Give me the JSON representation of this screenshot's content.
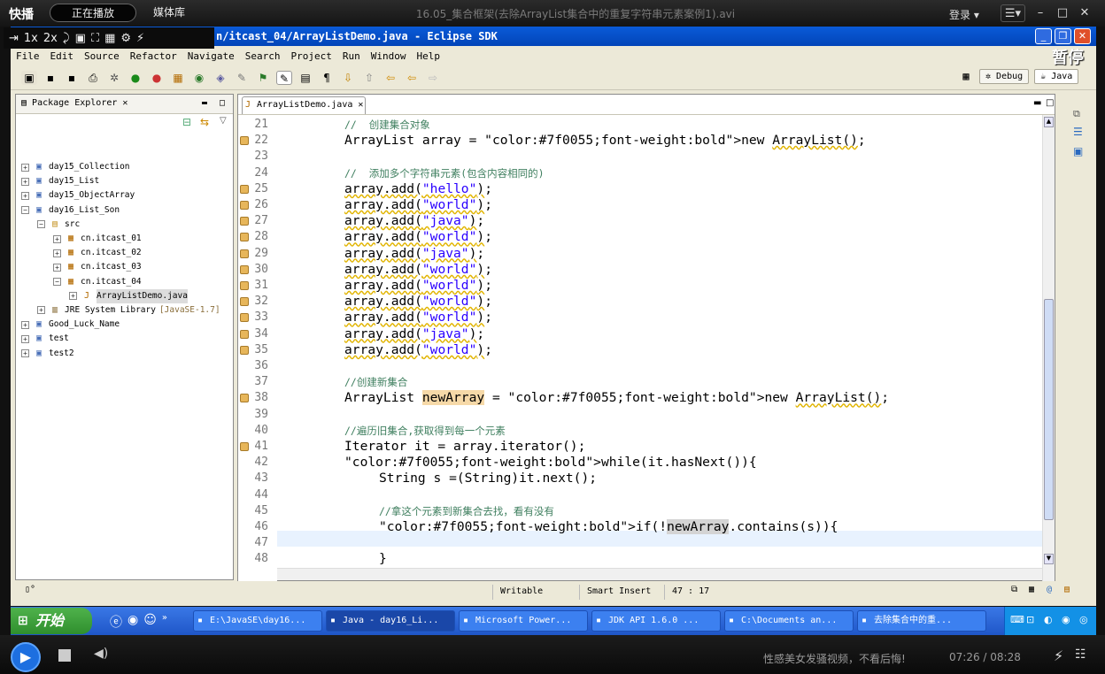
{
  "player": {
    "brand": "快播",
    "tabs": [
      "正在播放",
      "媒体库"
    ],
    "video_title": "16.05_集合框架(去除ArrayList集合中的重复字符串元素案例1).avi",
    "login": "登录",
    "overlay_tools": [
      "⇥",
      "1x",
      "2x"
    ],
    "pause_label": "暂停",
    "ad_text": "性感美女发骚视频，不看后悔!",
    "time": "07:26 / 08:28"
  },
  "eclipse": {
    "window_title": "n/itcast_04/ArrayListDemo.java - Eclipse SDK",
    "menus": [
      "File",
      "Edit",
      "Source",
      "Refactor",
      "Navigate",
      "Search",
      "Project",
      "Run",
      "Window",
      "Help"
    ],
    "perspectives": [
      "Debug",
      "Java"
    ],
    "package_explorer": {
      "title": "Package Explorer",
      "tree": [
        {
          "label": "day15_Collection",
          "level": 0,
          "expanded": false
        },
        {
          "label": "day15_List",
          "level": 0,
          "expanded": false
        },
        {
          "label": "day15_ObjectArray",
          "level": 0,
          "expanded": false
        },
        {
          "label": "day16_List_Son",
          "level": 0,
          "expanded": true
        },
        {
          "label": "src",
          "level": 1,
          "expanded": true
        },
        {
          "label": "cn.itcast_01",
          "level": 2,
          "expanded": false
        },
        {
          "label": "cn.itcast_02",
          "level": 2,
          "expanded": false
        },
        {
          "label": "cn.itcast_03",
          "level": 2,
          "expanded": false
        },
        {
          "label": "cn.itcast_04",
          "level": 2,
          "expanded": true
        },
        {
          "label": "ArrayListDemo.java",
          "level": 3,
          "expanded": false,
          "selected": true
        },
        {
          "label": "JRE System Library",
          "suffix": "[JavaSE-1.7]",
          "level": 1,
          "expanded": false
        },
        {
          "label": "Good_Luck_Name",
          "level": 0,
          "expanded": false
        },
        {
          "label": "test",
          "level": 0,
          "expanded": false
        },
        {
          "label": "test2",
          "level": 0,
          "expanded": false
        }
      ]
    },
    "editor_tab": "ArrayListDemo.java",
    "code_lines": [
      {
        "n": "21",
        "text": "//  创建集合对象",
        "indent": 0,
        "cls": "cm",
        "marker": false
      },
      {
        "n": "22",
        "text": "ArrayList array = new ArrayList();",
        "indent": 0,
        "cls": "",
        "marker": true
      },
      {
        "n": "23",
        "text": "",
        "indent": 0,
        "cls": "",
        "marker": false
      },
      {
        "n": "24",
        "text": "//  添加多个字符串元素(包含内容相同的)",
        "indent": 0,
        "cls": "cm",
        "marker": false
      },
      {
        "n": "25",
        "text": "array.add(\"hello\");",
        "indent": 0,
        "cls": "",
        "marker": true
      },
      {
        "n": "26",
        "text": "array.add(\"world\");",
        "indent": 0,
        "cls": "",
        "marker": true
      },
      {
        "n": "27",
        "text": "array.add(\"java\");",
        "indent": 0,
        "cls": "",
        "marker": true
      },
      {
        "n": "28",
        "text": "array.add(\"world\");",
        "indent": 0,
        "cls": "",
        "marker": true
      },
      {
        "n": "29",
        "text": "array.add(\"java\");",
        "indent": 0,
        "cls": "",
        "marker": true
      },
      {
        "n": "30",
        "text": "array.add(\"world\");",
        "indent": 0,
        "cls": "",
        "marker": true
      },
      {
        "n": "31",
        "text": "array.add(\"world\");",
        "indent": 0,
        "cls": "",
        "marker": true
      },
      {
        "n": "32",
        "text": "array.add(\"world\");",
        "indent": 0,
        "cls": "",
        "marker": true
      },
      {
        "n": "33",
        "text": "array.add(\"world\");",
        "indent": 0,
        "cls": "",
        "marker": true
      },
      {
        "n": "34",
        "text": "array.add(\"java\");",
        "indent": 0,
        "cls": "",
        "marker": true
      },
      {
        "n": "35",
        "text": "array.add(\"world\");",
        "indent": 0,
        "cls": "",
        "marker": true
      },
      {
        "n": "36",
        "text": "",
        "indent": 0,
        "cls": "",
        "marker": false
      },
      {
        "n": "37",
        "text": "//创建新集合",
        "indent": 0,
        "cls": "cm",
        "marker": false
      },
      {
        "n": "38",
        "text": "ArrayList newArray = new ArrayList();",
        "indent": 0,
        "cls": "",
        "marker": true
      },
      {
        "n": "39",
        "text": "",
        "indent": 0,
        "cls": "",
        "marker": false
      },
      {
        "n": "40",
        "text": "//遍历旧集合,获取得到每一个元素",
        "indent": 0,
        "cls": "cm",
        "marker": false
      },
      {
        "n": "41",
        "text": "Iterator it = array.iterator();",
        "indent": 0,
        "cls": "",
        "marker": true
      },
      {
        "n": "42",
        "text": "while(it.hasNext()){",
        "indent": 0,
        "cls": "",
        "marker": false
      },
      {
        "n": "43",
        "text": "String s =(String)it.next();",
        "indent": 1,
        "cls": "",
        "marker": false
      },
      {
        "n": "44",
        "text": "",
        "indent": 0,
        "cls": "",
        "marker": false
      },
      {
        "n": "45",
        "text": "//拿这个元素到新集合去找，看有没有",
        "indent": 1,
        "cls": "cm",
        "marker": false
      },
      {
        "n": "46",
        "text": "if(!newArray.contains(s)){",
        "indent": 1,
        "cls": "",
        "marker": false
      },
      {
        "n": "47",
        "text": "",
        "indent": 0,
        "cls": "",
        "marker": false
      },
      {
        "n": "48",
        "text": "}",
        "indent": 1,
        "cls": "",
        "marker": false
      }
    ],
    "status": {
      "writable": "Writable",
      "insert_mode": "Smart Insert",
      "position": "47 : 17"
    }
  },
  "taskbar": {
    "start": "开始",
    "tasks": [
      "E:\\JavaSE\\day16...",
      "Java - day16_Li...",
      "Microsoft Power...",
      "JDK API 1.6.0 ...",
      "C:\\Documents an...",
      "去除集合中的重..."
    ],
    "active_index": 1
  },
  "colors": {
    "accent": "#0a5bd8",
    "comment": "#3f7f5f",
    "keyword": "#7f0055",
    "marker": "#e7b65a"
  }
}
